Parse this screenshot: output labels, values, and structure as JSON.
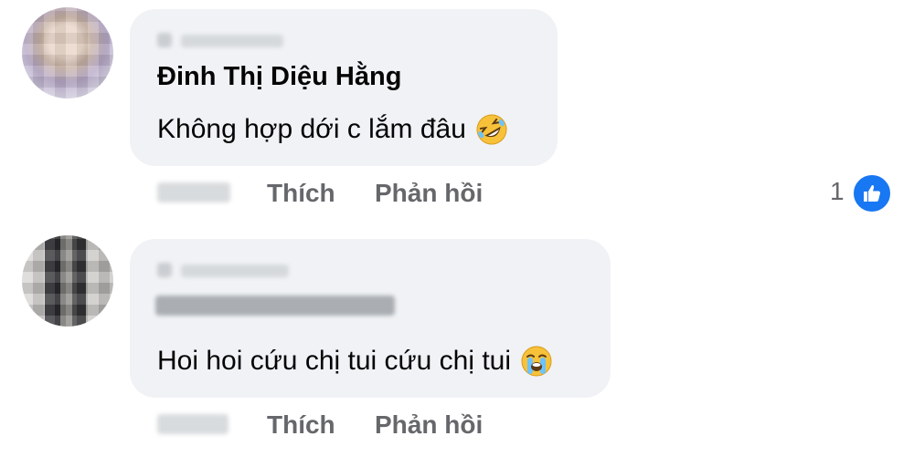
{
  "comments": [
    {
      "author": "Đinh Thị Diệu Hằng",
      "text": "Không hợp dới c lắm đâu",
      "emoji": "rolling-on-floor-laughing-emoji",
      "actions": {
        "like": "Thích",
        "reply": "Phản hồi"
      },
      "reactions": {
        "count": "1",
        "icon": "thumbs-up-icon"
      }
    },
    {
      "text": "Hoi hoi cứu chị tui cứu chị tui",
      "emoji": "loudly-crying-face-emoji",
      "actions": {
        "like": "Thích",
        "reply": "Phản hồi"
      }
    }
  ],
  "colors": {
    "bubble": "#f0f2f5",
    "action_text": "#65676b",
    "like_blue": "#1877f2"
  }
}
